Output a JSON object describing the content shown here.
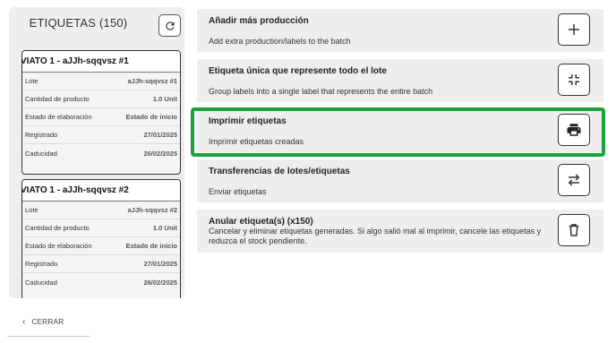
{
  "left": {
    "title": "ETIQUETAS (150)",
    "refresh_icon": "refresh-icon",
    "cards": [
      {
        "header": "VIATO 1 - aJJh-sqqvsz   #1",
        "rows": [
          {
            "key": "Lote",
            "value": "aJJh-sqqvsz   #1"
          },
          {
            "key": "Cantidad de producto",
            "value": "1.0 Unit"
          },
          {
            "key": "Estado de elaboración",
            "value": "Estado de inicio"
          },
          {
            "key": "Registrado",
            "value": "27/01/2025"
          },
          {
            "key": "Caducidad",
            "value": "26/02/2025"
          }
        ]
      },
      {
        "header": "VIATO 1 - aJJh-sqqvsz   #2",
        "rows": [
          {
            "key": "Lote",
            "value": "aJJh-sqqvsz   #2"
          },
          {
            "key": "Cantidad de producto",
            "value": "1.0 Unit"
          },
          {
            "key": "Estado de elaboración",
            "value": "Estado de inicio"
          },
          {
            "key": "Registrado",
            "value": "27/01/2025"
          },
          {
            "key": "Caducidad",
            "value": "26/02/2025"
          }
        ]
      }
    ],
    "close_label": "CERRAR"
  },
  "actions": [
    {
      "title": "Añadir más producción",
      "desc": "Add extra production/labels to the batch",
      "icon": "plus-icon"
    },
    {
      "title": "Etiqueta única que represente todo el lote",
      "desc": "Group labels into a single label that represents the entire batch",
      "icon": "collapse-icon"
    },
    {
      "title": "Imprimir etiquetas",
      "desc": "Imprimir etiquetas creadas",
      "icon": "printer-icon",
      "highlighted": true
    },
    {
      "title": "Transferencias de lotes/etiquetas",
      "desc": "Enviar etiquetas",
      "icon": "transfer-icon"
    },
    {
      "title": "Anular etiqueta(s) (x150)",
      "desc": "Cancelar y eliminar etiquetas generadas. Si algo salió mal al imprimir, cancele las etiquetas y reduzca el stock pendiente.",
      "icon": "trash-icon"
    }
  ],
  "colors": {
    "highlight": "#1aa33b",
    "panel": "#eeeeee"
  }
}
